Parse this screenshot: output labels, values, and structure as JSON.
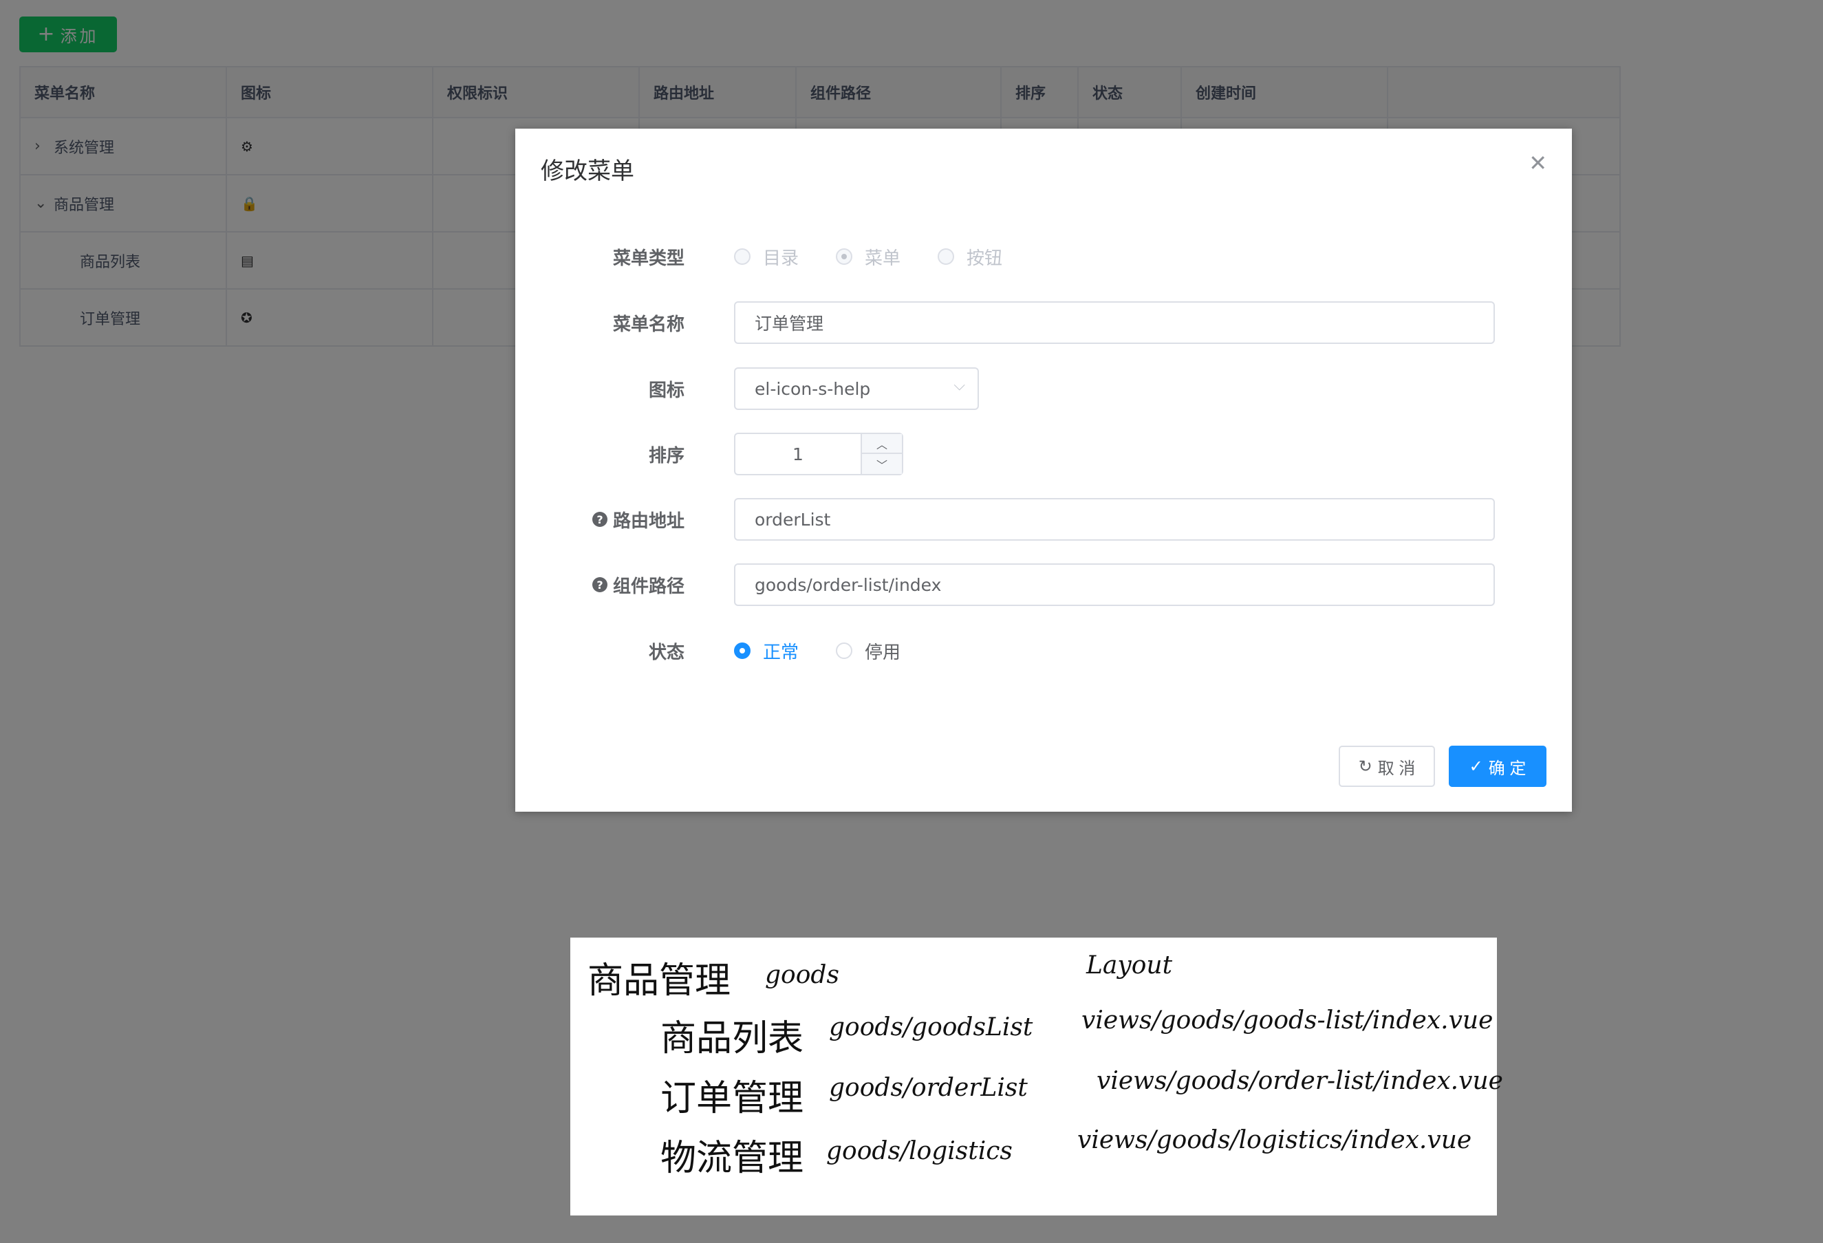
{
  "toolbar": {
    "add_label": "添加"
  },
  "table": {
    "headers": [
      "菜单名称",
      "图标",
      "权限标识",
      "路由地址",
      "组件路径",
      "排序",
      "状态",
      "创建时间",
      ""
    ],
    "rows": [
      {
        "name": "系统管理",
        "expander": "›",
        "icon": "⚙",
        "icon_name": "gear-icon"
      },
      {
        "name": "商品管理",
        "expander": "⌄",
        "icon": "🔒",
        "icon_name": "lock-icon"
      },
      {
        "name": "商品列表",
        "expander": "",
        "icon": "▤",
        "icon_name": "document-icon"
      },
      {
        "name": "订单管理",
        "expander": "",
        "icon": "✪",
        "icon_name": "help-circle-icon"
      }
    ]
  },
  "dialog": {
    "title": "修改菜单",
    "close_glyph": "✕",
    "menu_type": {
      "label": "菜单类型",
      "options": [
        "目录",
        "菜单",
        "按钮"
      ],
      "selected": "菜单"
    },
    "menu_name": {
      "label": "菜单名称",
      "value": "订单管理"
    },
    "icon": {
      "label": "图标",
      "value": "el-icon-s-help"
    },
    "sort": {
      "label": "排序",
      "value": "1"
    },
    "route": {
      "label": "路由地址",
      "value": "orderList"
    },
    "component": {
      "label": "组件路径",
      "value": "goods/order-list/index"
    },
    "status": {
      "label": "状态",
      "options": [
        "正常",
        "停用"
      ],
      "selected": "正常"
    },
    "cancel_label": "取 消",
    "confirm_label": "确 定"
  },
  "note": {
    "rows": [
      {
        "name": "商品管理",
        "route": "goods",
        "component": "Layout"
      },
      {
        "name": "商品列表",
        "route": "goods/goodsList",
        "component": "views/goods/goods-list/index.vue"
      },
      {
        "name": "订单管理",
        "route": "goods/orderList",
        "component": "views/goods/order-list/index.vue"
      },
      {
        "name": "物流管理",
        "route": "goods/logistics",
        "component": "views/goods/logistics/index.vue"
      }
    ]
  },
  "colors": {
    "primary": "#1890ff",
    "success": "#13ce66",
    "mask": "rgba(0,0,0,0.5)"
  }
}
